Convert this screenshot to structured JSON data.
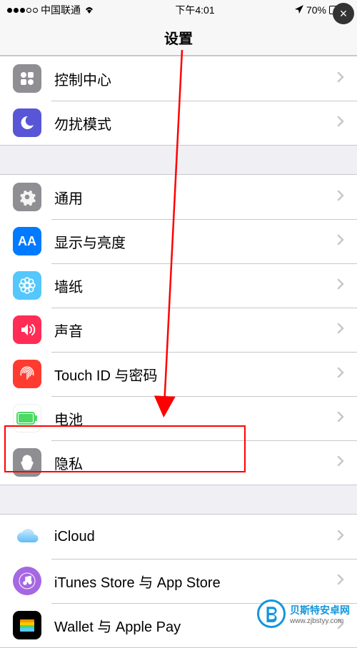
{
  "status": {
    "carrier": "中国联通",
    "time": "下午4:01",
    "battery_pct": "70%",
    "wifi": true,
    "location": true
  },
  "nav": {
    "title": "设置"
  },
  "groups": [
    {
      "rows": [
        {
          "id": "control-center",
          "icon": "control-center-icon",
          "label": "控制中心"
        },
        {
          "id": "dnd",
          "icon": "moon-icon",
          "label": "勿扰模式"
        }
      ]
    },
    {
      "rows": [
        {
          "id": "general",
          "icon": "gear-icon",
          "label": "通用"
        },
        {
          "id": "display",
          "icon": "aa-icon",
          "label": "显示与亮度"
        },
        {
          "id": "wallpaper",
          "icon": "flower-icon",
          "label": "墙纸"
        },
        {
          "id": "sound",
          "icon": "speaker-icon",
          "label": "声音"
        },
        {
          "id": "touchid",
          "icon": "fingerprint-icon",
          "label": "Touch ID 与密码"
        },
        {
          "id": "battery",
          "icon": "battery-icon",
          "label": "电池"
        },
        {
          "id": "privacy",
          "icon": "hand-icon",
          "label": "隐私",
          "highlighted": true
        }
      ]
    },
    {
      "rows": [
        {
          "id": "icloud",
          "icon": "cloud-icon",
          "label": "iCloud",
          "sub": ""
        },
        {
          "id": "itunes",
          "icon": "itunes-icon",
          "label": "iTunes Store 与 App Store"
        },
        {
          "id": "wallet",
          "icon": "wallet-icon",
          "label": "Wallet 与 Apple Pay"
        }
      ]
    }
  ],
  "watermark": {
    "title": "贝斯特安卓网",
    "url": "www.zjbstyy.com"
  },
  "overlay": {
    "close_label": "×"
  }
}
